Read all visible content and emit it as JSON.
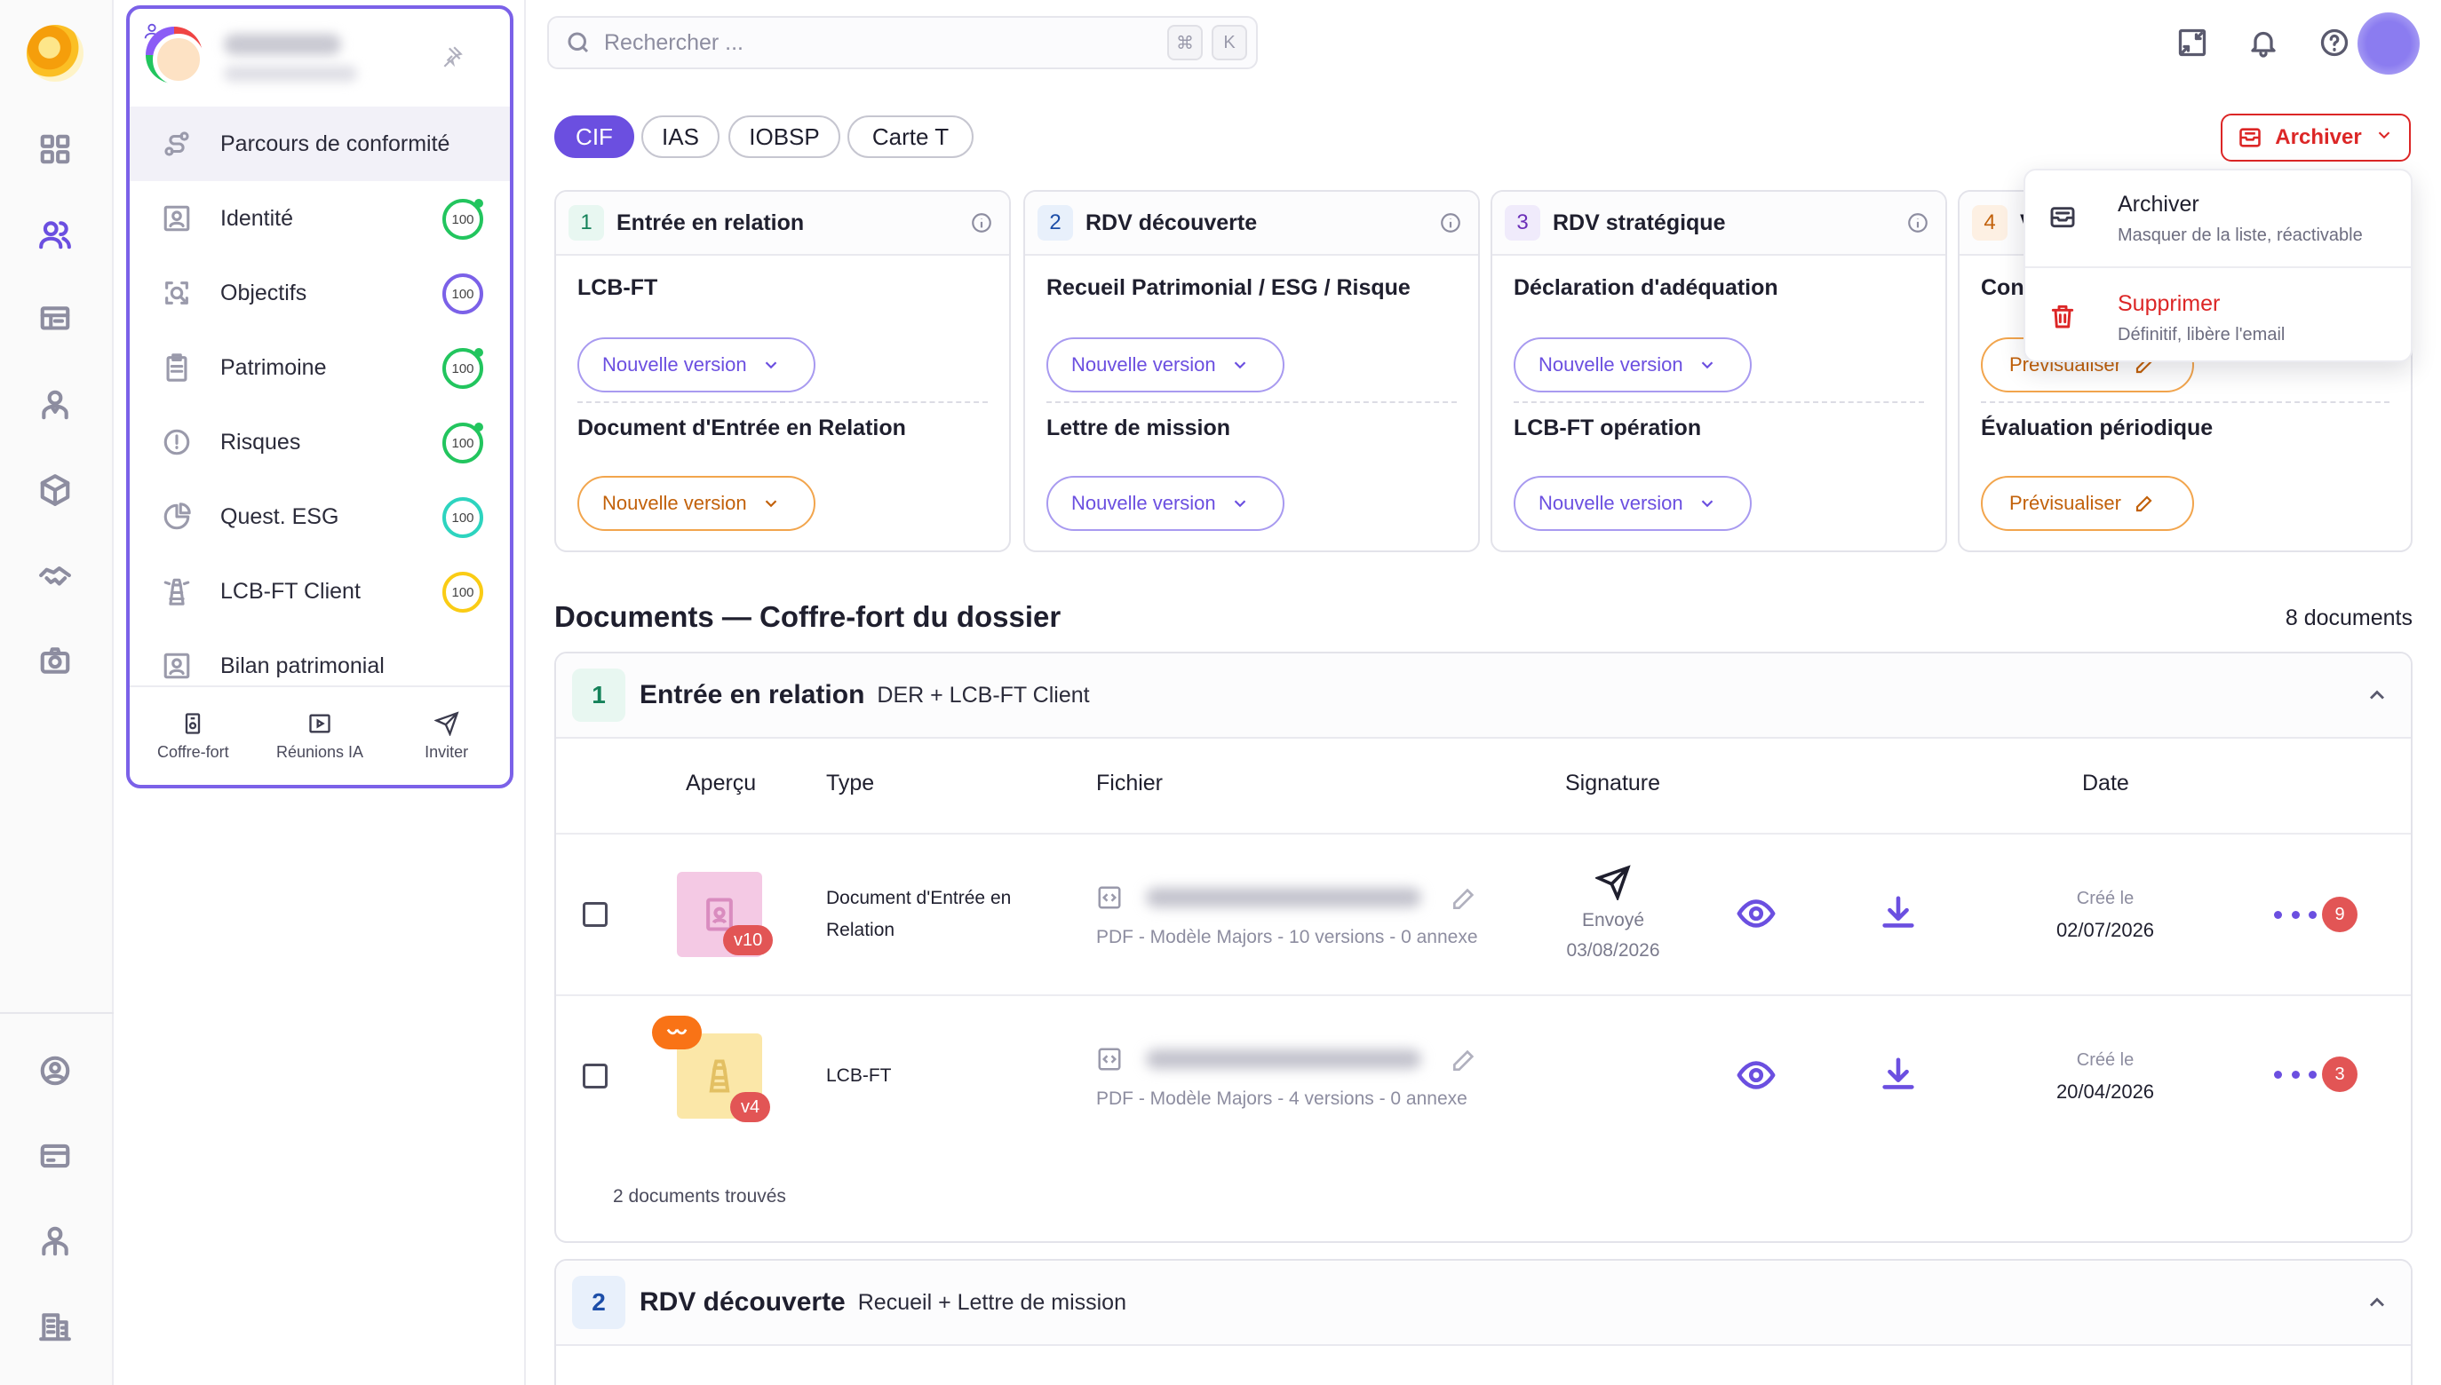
{
  "search": {
    "placeholder": "Rechercher ...",
    "kbd1": "⌘",
    "kbd2": "K"
  },
  "profile": {
    "name_blurred": "",
    "subtitle_blurred": ""
  },
  "sidebar": {
    "items": [
      {
        "label": "Parcours de conformité",
        "icon": "route-icon"
      },
      {
        "label": "Identité",
        "icon": "id-card-icon",
        "score": "100"
      },
      {
        "label": "Objectifs",
        "icon": "target-icon",
        "score": "100"
      },
      {
        "label": "Patrimoine",
        "icon": "clipboard-icon",
        "score": "100"
      },
      {
        "label": "Risques",
        "icon": "alert-icon",
        "score": "100"
      },
      {
        "label": "Quest. ESG",
        "icon": "pie-icon",
        "score": "100"
      },
      {
        "label": "LCB-FT Client",
        "icon": "lighthouse-icon",
        "score": "100"
      },
      {
        "label": "Bilan patrimonial",
        "icon": "portrait-icon"
      }
    ],
    "footer": [
      {
        "label": "Coffre-fort",
        "icon": "safe-icon"
      },
      {
        "label": "Réunions IA",
        "icon": "video-icon"
      },
      {
        "label": "Inviter",
        "icon": "send-icon"
      }
    ]
  },
  "tabs": [
    "CIF",
    "IAS",
    "IOBSP",
    "Carte T"
  ],
  "archive_button": "Archiver",
  "dropdown": {
    "archive": {
      "title": "Archiver",
      "subtitle": "Masquer de la liste, réactivable"
    },
    "delete": {
      "title": "Supprimer",
      "subtitle": "Définitif, libère l'email"
    }
  },
  "phases": [
    {
      "num": "1",
      "title": "Entrée en relation",
      "doc1": "LCB-FT",
      "btn1": "Nouvelle version",
      "doc2": "Document d'Entrée en Relation",
      "btn2": "Nouvelle version"
    },
    {
      "num": "2",
      "title": "RDV découverte",
      "doc1": "Recueil Patrimonial / ESG / Risque",
      "btn1": "Nouvelle version",
      "doc2": "Lettre de mission",
      "btn2": "Nouvelle version"
    },
    {
      "num": "3",
      "title": "RDV stratégique",
      "doc1": "Déclaration d'adéquation",
      "btn1": "Nouvelle version",
      "doc2": "LCB-FT opération",
      "btn2": "Nouvelle version"
    },
    {
      "num": "4",
      "title": "V",
      "doc1": "Con",
      "btn1": "Prévisualiser",
      "doc2": "Évaluation périodique",
      "btn2": "Prévisualiser"
    }
  ],
  "documents": {
    "title": "Documents — Coffre-fort du dossier",
    "count": "8 documents",
    "sections": [
      {
        "num": "1",
        "title": "Entrée en relation",
        "subtitle": "DER + LCB-FT Client"
      },
      {
        "num": "2",
        "title": "RDV découverte",
        "subtitle": "Recueil + Lettre de mission"
      }
    ],
    "columns": [
      "Aperçu",
      "Type",
      "Fichier",
      "Signature",
      "Date"
    ],
    "rows": [
      {
        "type_line1": "Document d'Entrée en",
        "type_line2": "Relation",
        "version": "v10",
        "file_meta": "PDF - Modèle Majors - 10 versions - 0 annexe",
        "signature_status": "Envoyé",
        "signature_date": "03/08/2026",
        "date_label": "Créé le",
        "date": "02/07/2026",
        "count": "9"
      },
      {
        "type_line1": "LCB-FT",
        "type_line2": "",
        "version": "v4",
        "file_meta": "PDF - Modèle Majors - 4 versions - 0 annexe",
        "signature_status": "",
        "signature_date": "",
        "date_label": "Créé le",
        "date": "20/04/2026",
        "count": "3"
      }
    ],
    "found": "2 documents trouvés"
  },
  "colors": {
    "accent": "#6b4fe0",
    "danger": "#dc2626",
    "orange": "#f97316"
  }
}
